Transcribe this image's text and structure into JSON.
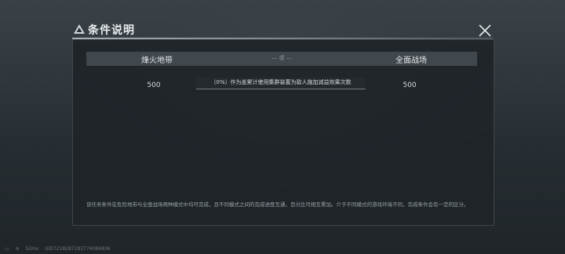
{
  "dialog": {
    "title": "条件说明",
    "close_icon": "close-icon"
  },
  "columns": {
    "left": "烽火地带",
    "separator": "— 或 —",
    "right": "全面战场"
  },
  "values": {
    "left": "500",
    "right": "500",
    "condition": "（0%）作为盖累计使用集群装置为敌人施加减益效果次数"
  },
  "note": "该任务条件在危险地带与全面战场两种模式中均可完成，且不同模式之间的完成进度互通，百分比可相互累加。介于不同模式的游戏环境不同，完成条件会有一定的区分。",
  "status": {
    "ping": "52ms",
    "uid": "UID7218287183774084836"
  }
}
